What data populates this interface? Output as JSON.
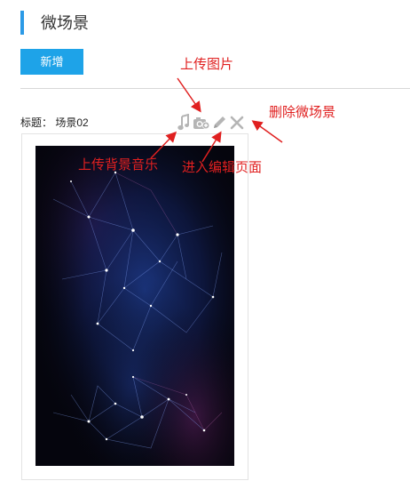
{
  "page": {
    "title": "微场景"
  },
  "toolbar": {
    "add_label": "新增"
  },
  "scene": {
    "label_prefix": "标题：",
    "name": "场景02"
  },
  "tools": [
    {
      "icon": "music-note-icon"
    },
    {
      "icon": "camera-add-icon"
    },
    {
      "icon": "pencil-icon"
    },
    {
      "icon": "close-icon"
    }
  ],
  "annotations": {
    "upload_image": "上传图片",
    "delete_scene": "删除微场景",
    "upload_music": "上传背景音乐",
    "enter_edit": "进入编辑页面",
    "color": "#e02020"
  },
  "colors": {
    "accent": "#1ea3e8",
    "title_bar": "#2b9ae6",
    "icon_gray": "#b5b5b5"
  }
}
